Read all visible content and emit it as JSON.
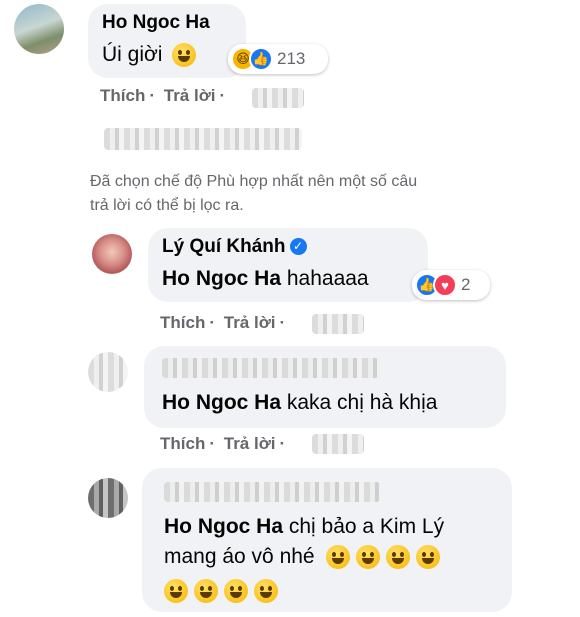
{
  "comment1": {
    "author": "Ho Ngoc Ha",
    "text": "Úi giời",
    "reaction_count": "213",
    "actions": {
      "like": "Thích",
      "reply": "Trả lời"
    }
  },
  "filter_note": "Đã chọn chế độ Phù hợp nhất nên một số câu trả lời có thể bị lọc ra.",
  "reply1": {
    "author": "Lý Quí Khánh",
    "mention": "Ho Ngoc Ha",
    "text": "hahaaaa",
    "reaction_count": "2",
    "actions": {
      "like": "Thích",
      "reply": "Trả lời"
    }
  },
  "reply2": {
    "mention": "Ho Ngoc Ha",
    "text": "kaka chị hà khịa",
    "actions": {
      "like": "Thích",
      "reply": "Trả lời"
    }
  },
  "reply3": {
    "mention": "Ho Ngoc Ha",
    "text_line1": "chị bảo a Kim Lý",
    "text_line2": "mang áo vô nhé"
  },
  "colors": {
    "bubble": "#f0f2f5",
    "like_blue": "#1877f2",
    "love_red": "#f33e58",
    "haha_yellow": "#f7b500"
  }
}
